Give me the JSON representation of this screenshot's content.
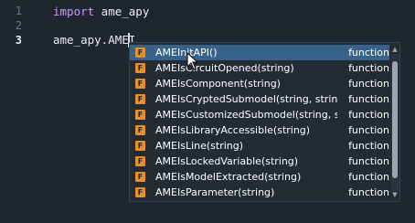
{
  "editor": {
    "line_numbers": [
      "1",
      "2",
      "3"
    ],
    "lines": {
      "line1_keyword": "import",
      "line1_rest": " ame_apy",
      "line3": "ame_apy.AMEI"
    }
  },
  "autocomplete": {
    "items": [
      {
        "icon": "F",
        "label": "AMEInitAPI()",
        "kind": "function"
      },
      {
        "icon": "F",
        "label": "AMEIsCircuitOpened(string)",
        "kind": "function"
      },
      {
        "icon": "F",
        "label": "AMEIsComponent(string)",
        "kind": "function"
      },
      {
        "icon": "F",
        "label": "AMEIsCryptedSubmodel(string, string)",
        "kind": "function"
      },
      {
        "icon": "F",
        "label": "AMEIsCustomizedSubmodel(string, string)",
        "kind": "function"
      },
      {
        "icon": "F",
        "label": "AMEIsLibraryAccessible(string)",
        "kind": "function"
      },
      {
        "icon": "F",
        "label": "AMEIsLine(string)",
        "kind": "function"
      },
      {
        "icon": "F",
        "label": "AMEIsLockedVariable(string)",
        "kind": "function"
      },
      {
        "icon": "F",
        "label": "AMEIsModelExtracted(string)",
        "kind": "function"
      },
      {
        "icon": "F",
        "label": "AMEIsParameter(string)",
        "kind": "function"
      }
    ],
    "selected_index": 0,
    "colors": {
      "selected_bg": "#37628a",
      "badge": "#e88f2a"
    }
  }
}
